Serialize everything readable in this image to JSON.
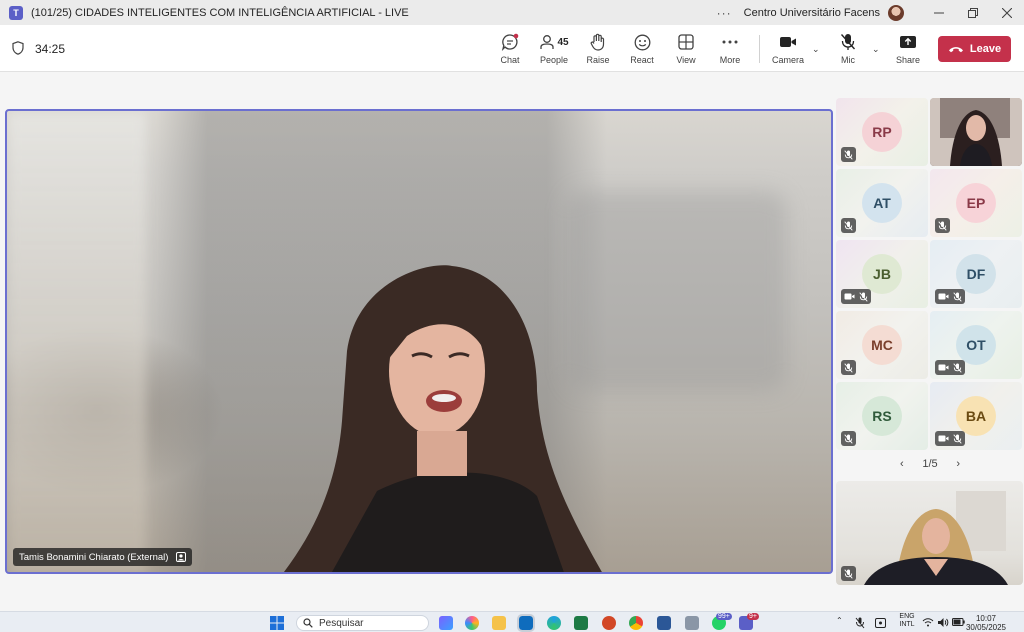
{
  "window": {
    "title": "(101/25) CIDADES INTELIGENTES COM INTELIGÊNCIA ARTIFICIAL - LIVE",
    "org": "Centro Universitário Facens"
  },
  "toolbar": {
    "timer": "34:25",
    "chat": "Chat",
    "people": "People",
    "people_count": "45",
    "raise": "Raise",
    "react": "React",
    "view": "View",
    "more": "More",
    "camera": "Camera",
    "mic": "Mic",
    "share": "Share",
    "leave": "Leave"
  },
  "stage": {
    "speaker_name": "Tamis Bonamini Chiarato (External)"
  },
  "gallery": {
    "tiles": [
      {
        "initials": "RP"
      },
      {
        "initials": ""
      },
      {
        "initials": "AT"
      },
      {
        "initials": "EP"
      },
      {
        "initials": "JB"
      },
      {
        "initials": "DF"
      },
      {
        "initials": "MC"
      },
      {
        "initials": "OT"
      },
      {
        "initials": "RS"
      },
      {
        "initials": "BA"
      }
    ],
    "page": "1/5"
  },
  "taskbar": {
    "search_placeholder": "Pesquisar",
    "lang": "ENG",
    "lang_sub": "INTL",
    "time": "10:07",
    "date": "30/05/2025",
    "whatsapp_badge": "99+",
    "teams_badge": "9+"
  },
  "colors": {
    "accent": "#5b5fc7",
    "leave": "#c4314b",
    "stage_border": "#6b6fd0"
  }
}
